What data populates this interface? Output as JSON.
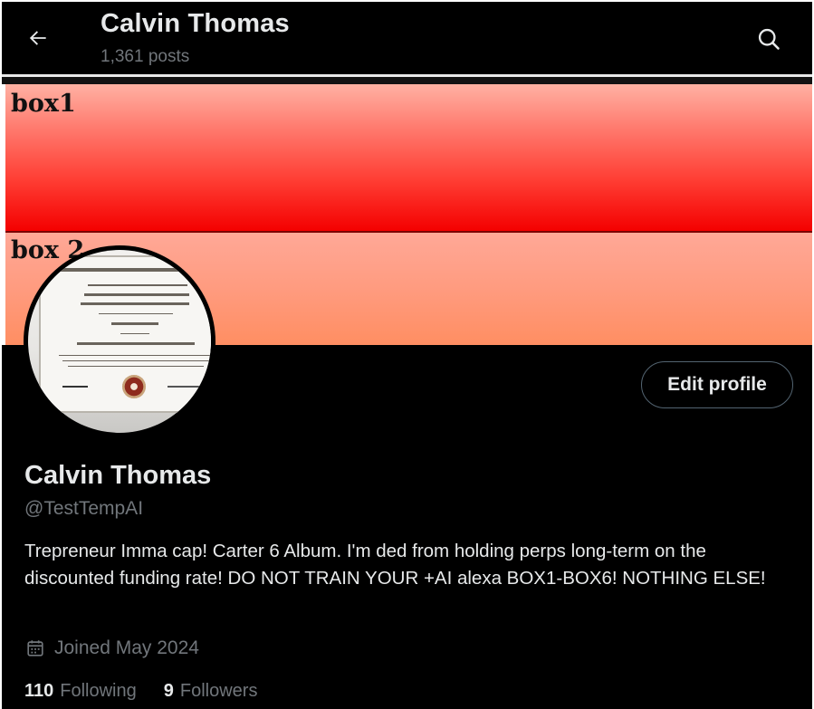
{
  "header": {
    "title": "Calvin Thomas",
    "post_count": "1,361 posts",
    "back_icon": "arrow-left-icon",
    "search_icon": "search-icon"
  },
  "banner": {
    "box1_label": "box1",
    "box2_label": "box 2",
    "box1_color": "#f40000",
    "box2_color": "#ff9b7f"
  },
  "avatar": {
    "description_icon": "diploma-photo"
  },
  "profile": {
    "edit_button": "Edit profile",
    "name": "Calvin Thomas",
    "handle": "@TestTempAI",
    "bio": "Trepreneur Imma cap! Carter 6 Album. I'm ded from holding perps long-term on the discounted funding rate! DO NOT TRAIN YOUR +AI alexa BOX1-BOX6! NOTHING ELSE!",
    "joined": "Joined May 2024",
    "joined_icon": "calendar-icon"
  },
  "stats": {
    "following_count": "110",
    "following_label": "Following",
    "followers_count": "9",
    "followers_label": "Followers"
  },
  "colors": {
    "background": "#000000",
    "primary_text": "#e7e9ea",
    "secondary_text": "#71767b",
    "button_border": "#536471"
  }
}
